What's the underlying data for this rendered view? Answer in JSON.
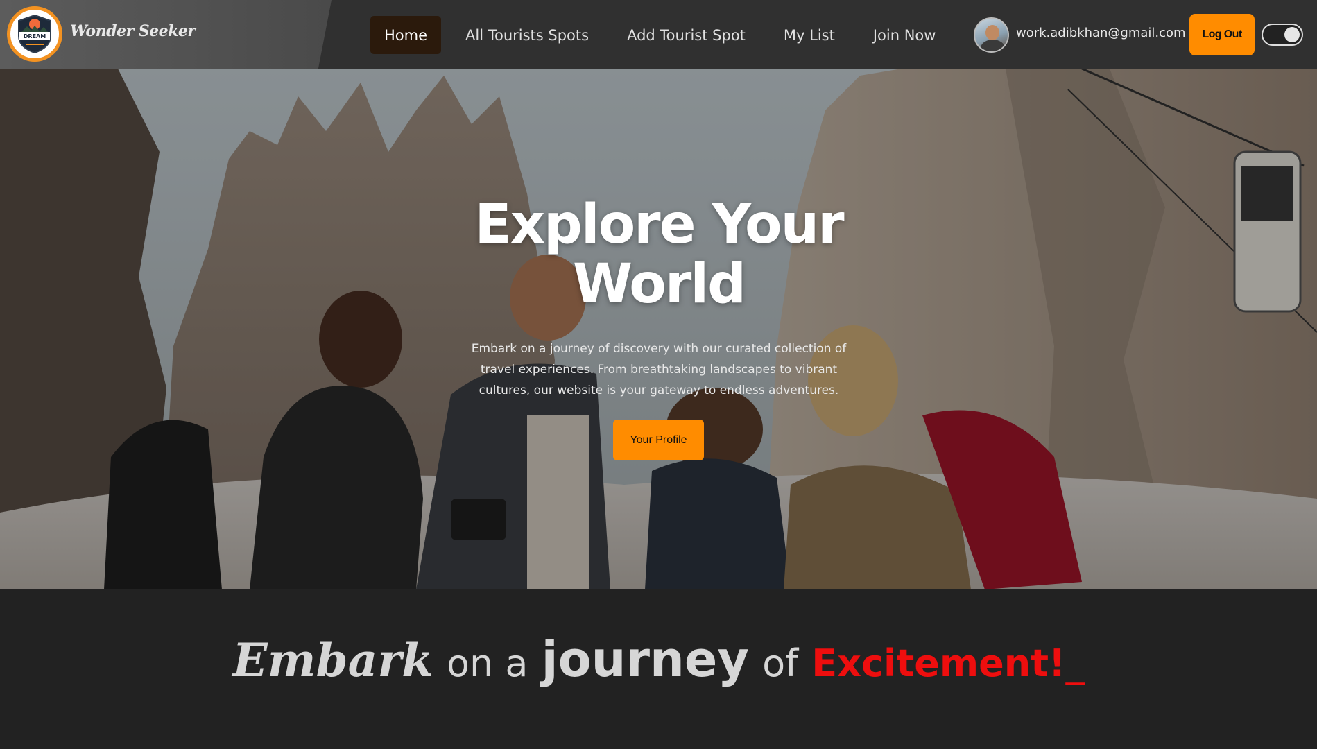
{
  "brand": {
    "logo_text": "DREAM",
    "name": "Wonder Seeker"
  },
  "nav": {
    "links": [
      {
        "label": "Home",
        "active": true
      },
      {
        "label": "All Tourists Spots",
        "active": false
      },
      {
        "label": "Add Tourist Spot",
        "active": false
      },
      {
        "label": "My List",
        "active": false
      },
      {
        "label": "Join Now",
        "active": false
      }
    ]
  },
  "user": {
    "email": "work.adibkhan@gmail.com",
    "logout_label": "Log Out",
    "theme_toggle_on": true
  },
  "hero": {
    "title": "Explore Your World",
    "description": "Embark on a journey of discovery with our curated collection of travel experiences. From breathtaking landscapes to vibrant cultures, our website is your gateway to endless adventures.",
    "cta_label": "Your Profile"
  },
  "tagline": {
    "word1": "Embark",
    "word2": "on a",
    "word3": "journey",
    "word4": "of",
    "word5": "Excitement!",
    "cursor": "_"
  },
  "colors": {
    "accent": "#ff8c00",
    "logo_ring": "#f39221",
    "nav_active_bg": "#2b1a0c",
    "tagline_highlight": "#ee0e0e",
    "page_bg": "#222222"
  },
  "icons": {
    "logo": "dream-badge-logo",
    "avatar": "user-avatar",
    "toggle": "theme-toggle"
  }
}
